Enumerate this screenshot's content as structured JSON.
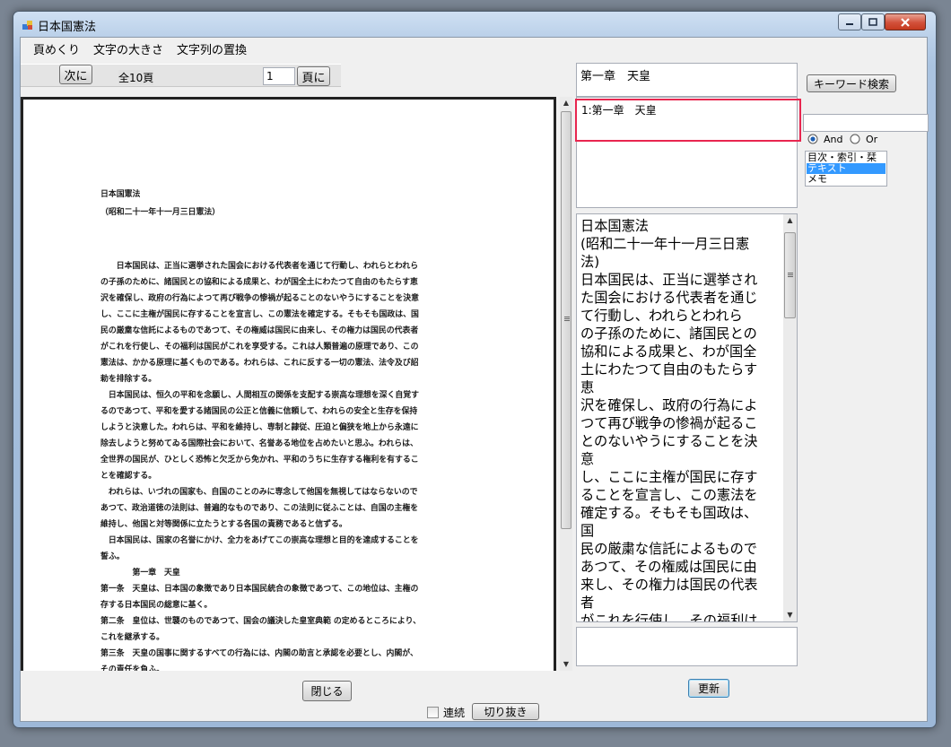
{
  "window": {
    "title": "日本国憲法"
  },
  "menu": [
    "頁めくり",
    "文字の大きさ",
    "文字列の置換"
  ],
  "toolbar": {
    "next_label": "次に",
    "total_pages": "全10頁",
    "page_input": "1",
    "goto_label": "頁に"
  },
  "document": {
    "lines": [
      "日本国憲法",
      "（昭和二十一年十一月三日憲法）",
      "",
      "",
      "　　日本国民は、正当に選挙された国会における代表者を通じて行動し、われらとわれら",
      "の子孫のために、諸国民との協和による成果と、わが国全土にわたつて自由のもたらす恵",
      "沢を確保し、政府の行為によつて再び戦争の惨禍が起ることのないやうにすることを決意",
      "し、ここに主権が国民に存することを宣言し、この憲法を確定する。そもそも国政は、国",
      "民の厳粛な信託によるものであつて、その権威は国民に由来し、その権力は国民の代表者",
      "がこれを行使し、その福利は国民がこれを享受する。これは人類普遍の原理であり、この",
      "憲法は、かかる原理に基くものである。われらは、これに反する一切の憲法、法令及び詔",
      "勅を排除する。",
      "　日本国民は、恒久の平和を念願し、人間相互の関係を支配する崇高な理想を深く自覚す",
      "るのであつて、平和を愛する諸国民の公正と信義に信頼して、われらの安全と生存を保持",
      "しようと決意した。われらは、平和を維持し、専制と隷従、圧迫と偏狭を地上から永遠に",
      "除去しようと努めてゐる国際社会において、名誉ある地位を占めたいと思ふ。われらは、",
      "全世界の国民が、ひとしく恐怖と欠乏から免かれ、平和のうちに生存する権利を有するこ",
      "とを確認する。",
      "　われらは、いづれの国家も、自国のことのみに専念して他国を無視してはならないので",
      "あつて、政治道徳の法則は、普遍的なものであり、この法則に従ふことは、自国の主権を",
      "維持し、他国と対等関係に立たうとする各国の責務であると信ずる。",
      "　日本国民は、国家の名誉にかけ、全力をあげてこの崇高な理想と目的を達成することを",
      "誓ふ。",
      "　　　　第一章　天皇",
      "第一条　天皇は、日本国の象徴であり日本国民統合の象徴であつて、この地位は、主権の",
      "存する日本国民の総意に基く。",
      "第二条　皇位は、世襲のものであつて、国会の議決した皇室典範 の定めるところにより、",
      "これを継承する。",
      "第三条　天皇の国事に関するすべての行為には、内閣の助言と承認を必要とし、内閣が、",
      "その責任を負ふ。"
    ]
  },
  "right": {
    "chapter_box": "第一章　天皇",
    "search_result": "1:第一章　天皇",
    "text_lines": [
      "日本国憲法",
      "(昭和二十一年十一月三日憲",
      "法)",
      "日本国民は、正当に選挙され",
      "た国会における代表者を通じ",
      "て行動し、われらとわれら",
      "の子孫のために、諸国民との",
      "協和による成果と、わが国全",
      "土にわたつて自由のもたらす",
      "恵",
      "沢を確保し、政府の行為によ",
      "つて再び戦争の惨禍が起るこ",
      "とのないやうにすることを決",
      "意",
      "し、ここに主権が国民に存す",
      "ることを宣言し、この憲法を",
      "確定する。そもそも国政は、",
      "国",
      "民の厳粛な信託によるもので",
      "あつて、その権威は国民に由",
      "来し、その権力は国民の代表",
      "者",
      "がこれを行使し、その福利は"
    ],
    "memo": ""
  },
  "search": {
    "keyword_button": "キーワード検索",
    "keyword_input": "",
    "and_label": "And",
    "or_label": "Or",
    "list": [
      "目次・索引・栞",
      "テキスト",
      "メモ"
    ],
    "selected_index": 1
  },
  "bottom": {
    "close_label": "閉じる",
    "update_label": "更新",
    "continuous_label": "連続",
    "cut_label": "切り抜き"
  },
  "colors": {
    "highlight_border": "#e8264f",
    "list_selection": "#3399ff"
  }
}
